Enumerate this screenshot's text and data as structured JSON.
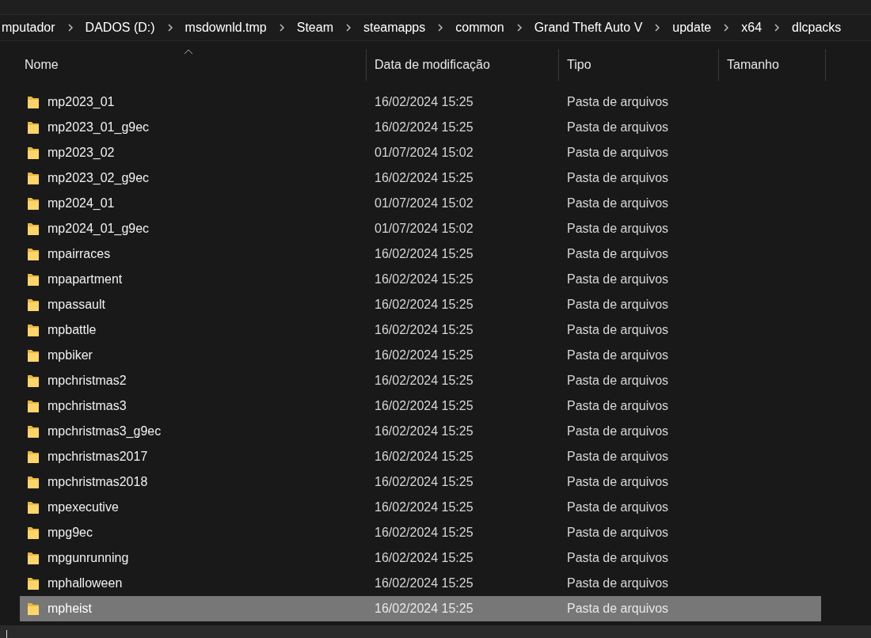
{
  "breadcrumb": [
    "mputador",
    "DADOS (D:)",
    "msdownld.tmp",
    "Steam",
    "steamapps",
    "common",
    "Grand Theft Auto V",
    "update",
    "x64",
    "dlcpacks"
  ],
  "table": {
    "columns": [
      {
        "label": "Nome",
        "sorted": true
      },
      {
        "label": "Data de modificação",
        "sorted": false
      },
      {
        "label": "Tipo",
        "sorted": false
      },
      {
        "label": "Tamanho",
        "sorted": false
      }
    ],
    "rows": [
      {
        "name": "mp2023_01",
        "date": "16/02/2024 15:25",
        "type": "Pasta de arquivos",
        "selected": false
      },
      {
        "name": "mp2023_01_g9ec",
        "date": "16/02/2024 15:25",
        "type": "Pasta de arquivos",
        "selected": false
      },
      {
        "name": "mp2023_02",
        "date": "01/07/2024 15:02",
        "type": "Pasta de arquivos",
        "selected": false
      },
      {
        "name": "mp2023_02_g9ec",
        "date": "16/02/2024 15:25",
        "type": "Pasta de arquivos",
        "selected": false
      },
      {
        "name": "mp2024_01",
        "date": "01/07/2024 15:02",
        "type": "Pasta de arquivos",
        "selected": false
      },
      {
        "name": "mp2024_01_g9ec",
        "date": "01/07/2024 15:02",
        "type": "Pasta de arquivos",
        "selected": false
      },
      {
        "name": "mpairraces",
        "date": "16/02/2024 15:25",
        "type": "Pasta de arquivos",
        "selected": false
      },
      {
        "name": "mpapartment",
        "date": "16/02/2024 15:25",
        "type": "Pasta de arquivos",
        "selected": false
      },
      {
        "name": "mpassault",
        "date": "16/02/2024 15:25",
        "type": "Pasta de arquivos",
        "selected": false
      },
      {
        "name": "mpbattle",
        "date": "16/02/2024 15:25",
        "type": "Pasta de arquivos",
        "selected": false
      },
      {
        "name": "mpbiker",
        "date": "16/02/2024 15:25",
        "type": "Pasta de arquivos",
        "selected": false
      },
      {
        "name": "mpchristmas2",
        "date": "16/02/2024 15:25",
        "type": "Pasta de arquivos",
        "selected": false
      },
      {
        "name": "mpchristmas3",
        "date": "16/02/2024 15:25",
        "type": "Pasta de arquivos",
        "selected": false
      },
      {
        "name": "mpchristmas3_g9ec",
        "date": "16/02/2024 15:25",
        "type": "Pasta de arquivos",
        "selected": false
      },
      {
        "name": "mpchristmas2017",
        "date": "16/02/2024 15:25",
        "type": "Pasta de arquivos",
        "selected": false
      },
      {
        "name": "mpchristmas2018",
        "date": "16/02/2024 15:25",
        "type": "Pasta de arquivos",
        "selected": false
      },
      {
        "name": "mpexecutive",
        "date": "16/02/2024 15:25",
        "type": "Pasta de arquivos",
        "selected": false
      },
      {
        "name": "mpg9ec",
        "date": "16/02/2024 15:25",
        "type": "Pasta de arquivos",
        "selected": false
      },
      {
        "name": "mpgunrunning",
        "date": "16/02/2024 15:25",
        "type": "Pasta de arquivos",
        "selected": false
      },
      {
        "name": "mphalloween",
        "date": "16/02/2024 15:25",
        "type": "Pasta de arquivos",
        "selected": false
      },
      {
        "name": "mpheist",
        "date": "16/02/2024 15:25",
        "type": "Pasta de arquivos",
        "selected": true
      }
    ]
  }
}
